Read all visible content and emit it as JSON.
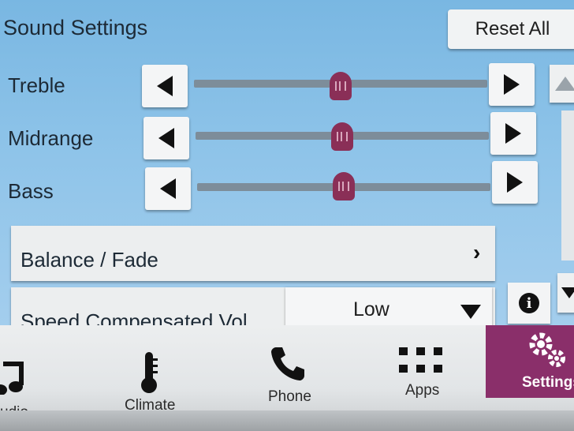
{
  "header": {
    "title": "Sound Settings",
    "reset_label": "Reset All"
  },
  "equalizer": [
    {
      "label": "Treble",
      "level": 0.5
    },
    {
      "label": "Midrange",
      "level": 0.5
    },
    {
      "label": "Bass",
      "level": 0.5
    }
  ],
  "list": {
    "balance_fade_label": "Balance / Fade",
    "speed_comp_label": "Speed Compensated Vol.",
    "speed_comp_value": "Low"
  },
  "nav": {
    "audio_label": "udio",
    "climate_label": "Climate",
    "phone_label": "Phone",
    "apps_label": "Apps",
    "settings_label": "Settings"
  },
  "colors": {
    "accent": "#8a2f6a",
    "thumb": "#8a2f57",
    "background": "#8fc4e9"
  }
}
